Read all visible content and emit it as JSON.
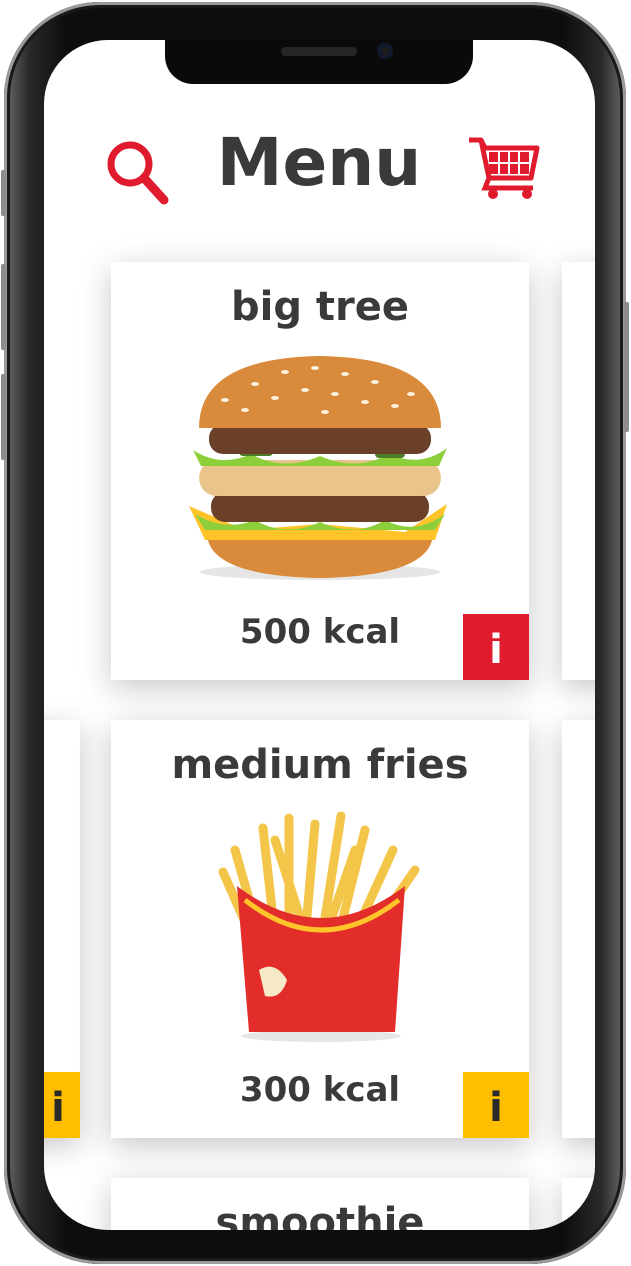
{
  "header": {
    "title": "Menu"
  },
  "icons": {
    "search": "search-icon",
    "cart": "cart-icon",
    "info": "info-icon"
  },
  "colors": {
    "accent_red": "#e01b2e",
    "accent_yellow": "#ffbf00",
    "text": "#3a3a3a"
  },
  "items": [
    {
      "name": "big tree",
      "kcal": "500 kcal",
      "info_label": "i",
      "image": "burger"
    },
    {
      "name": "medium fries",
      "kcal": "300 kcal",
      "info_label": "i",
      "image": "fries"
    },
    {
      "name": "smoothie"
    }
  ],
  "side_cards": {
    "left_info_label": "i"
  }
}
